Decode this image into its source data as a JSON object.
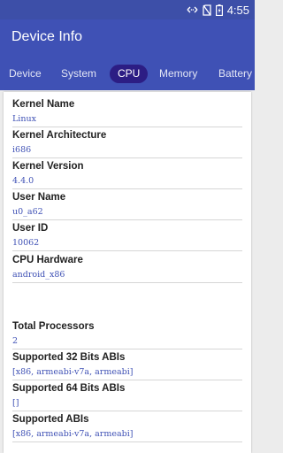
{
  "status_bar": {
    "time": "4:55",
    "icons": [
      "data-transfer-icon",
      "no-sim-icon",
      "battery-charging-icon"
    ]
  },
  "app_bar": {
    "title": "Device Info"
  },
  "tabs": [
    {
      "label": "Device"
    },
    {
      "label": "System"
    },
    {
      "label": "CPU",
      "active": true
    },
    {
      "label": "Memory"
    },
    {
      "label": "Battery"
    }
  ],
  "cpu_info": [
    {
      "label": "Kernel Name",
      "value": "Linux"
    },
    {
      "label": "Kernel Architecture",
      "value": "i686"
    },
    {
      "label": "Kernel Version",
      "value": "4.4.0"
    },
    {
      "label": "User Name",
      "value": "u0_a62"
    },
    {
      "label": "User ID",
      "value": "10062"
    },
    {
      "label": "CPU Hardware",
      "value": "android_x86"
    },
    {
      "label": "Total Processors",
      "value": "2"
    },
    {
      "label": "Supported 32 Bits ABIs",
      "value": "[x86, armeabi-v7a, armeabi]"
    },
    {
      "label": "Supported 64 Bits ABIs",
      "value": "[]"
    },
    {
      "label": "Supported ABIs",
      "value": "[x86, armeabi-v7a, armeabi]"
    }
  ],
  "colors": {
    "primary": "#3F51B5",
    "status_bar": "#3D4FA8",
    "active_tab": "#2C1D84",
    "value_text": "#3F51B5"
  }
}
